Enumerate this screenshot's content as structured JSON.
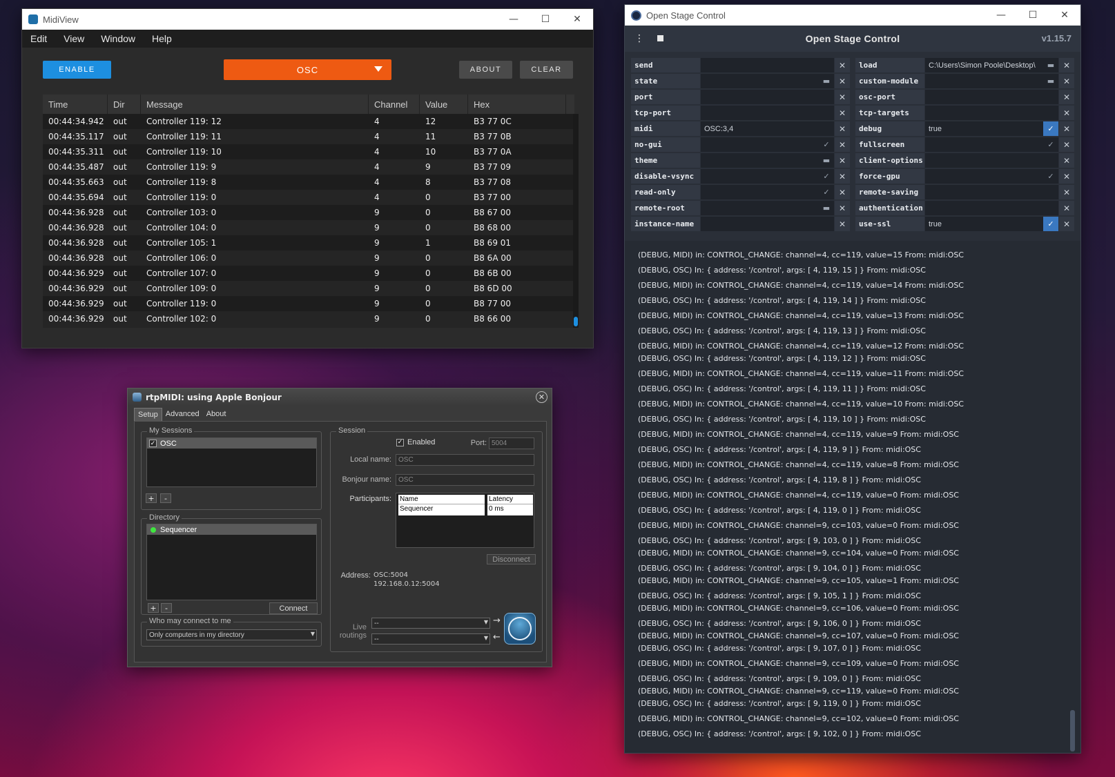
{
  "midiview": {
    "title": "MidiView",
    "menu": [
      "Edit",
      "View",
      "Window",
      "Help"
    ],
    "enable_label": "ENABLE",
    "port_selected": "OSC",
    "about_label": "ABOUT",
    "clear_label": "CLEAR",
    "columns": [
      "Time",
      "Dir",
      "Message",
      "Channel",
      "Value",
      "Hex"
    ],
    "rows": [
      [
        "00:44:34.942",
        "out",
        "Controller 119: 12",
        "4",
        "12",
        "B3 77 0C"
      ],
      [
        "00:44:35.117",
        "out",
        "Controller 119: 11",
        "4",
        "11",
        "B3 77 0B"
      ],
      [
        "00:44:35.311",
        "out",
        "Controller 119: 10",
        "4",
        "10",
        "B3 77 0A"
      ],
      [
        "00:44:35.487",
        "out",
        "Controller 119: 9",
        "4",
        "9",
        "B3 77 09"
      ],
      [
        "00:44:35.663",
        "out",
        "Controller 119: 8",
        "4",
        "8",
        "B3 77 08"
      ],
      [
        "00:44:35.694",
        "out",
        "Controller 119: 0",
        "4",
        "0",
        "B3 77 00"
      ],
      [
        "00:44:36.928",
        "out",
        "Controller 103: 0",
        "9",
        "0",
        "B8 67 00"
      ],
      [
        "00:44:36.928",
        "out",
        "Controller 104: 0",
        "9",
        "0",
        "B8 68 00"
      ],
      [
        "00:44:36.928",
        "out",
        "Controller 105: 1",
        "9",
        "1",
        "B8 69 01"
      ],
      [
        "00:44:36.928",
        "out",
        "Controller 106: 0",
        "9",
        "0",
        "B8 6A 00"
      ],
      [
        "00:44:36.929",
        "out",
        "Controller 107: 0",
        "9",
        "0",
        "B8 6B 00"
      ],
      [
        "00:44:36.929",
        "out",
        "Controller 109: 0",
        "9",
        "0",
        "B8 6D 00"
      ],
      [
        "00:44:36.929",
        "out",
        "Controller 119: 0",
        "9",
        "0",
        "B8 77 00"
      ],
      [
        "00:44:36.929",
        "out",
        "Controller 102: 0",
        "9",
        "0",
        "B8 66 00"
      ]
    ]
  },
  "osc": {
    "window_title": "Open Stage Control",
    "header_title": "Open Stage Control",
    "version": "v1.15.7",
    "options_left": [
      {
        "name": "send",
        "value": "",
        "icon": "none"
      },
      {
        "name": "state",
        "value": "",
        "icon": "folder"
      },
      {
        "name": "port",
        "value": "",
        "icon": "none"
      },
      {
        "name": "tcp-port",
        "value": "",
        "icon": "none"
      },
      {
        "name": "midi",
        "value": "OSC:3,4",
        "icon": "none"
      },
      {
        "name": "no-gui",
        "value": "",
        "icon": "check"
      },
      {
        "name": "theme",
        "value": "",
        "icon": "folder"
      },
      {
        "name": "disable-vsync",
        "value": "",
        "icon": "check"
      },
      {
        "name": "read-only",
        "value": "",
        "icon": "check"
      },
      {
        "name": "remote-root",
        "value": "",
        "icon": "folder"
      },
      {
        "name": "instance-name",
        "value": "",
        "icon": "none"
      }
    ],
    "options_right": [
      {
        "name": "load",
        "value": "C:\\Users\\Simon Poole\\Desktop\\",
        "icon": "folder"
      },
      {
        "name": "custom-module",
        "value": "",
        "icon": "folder"
      },
      {
        "name": "osc-port",
        "value": "",
        "icon": "none"
      },
      {
        "name": "tcp-targets",
        "value": "",
        "icon": "none"
      },
      {
        "name": "debug",
        "value": "true",
        "icon": "check-on"
      },
      {
        "name": "fullscreen",
        "value": "",
        "icon": "check"
      },
      {
        "name": "client-options",
        "value": "",
        "icon": "none"
      },
      {
        "name": "force-gpu",
        "value": "",
        "icon": "check"
      },
      {
        "name": "remote-saving",
        "value": "",
        "icon": "none"
      },
      {
        "name": "authentication",
        "value": "",
        "icon": "none"
      },
      {
        "name": "use-ssl",
        "value": "true",
        "icon": "check-on"
      }
    ],
    "log": [
      "(DEBUG, MIDI) in: CONTROL_CHANGE: channel=4, cc=119, value=15 From: midi:OSC",
      "(DEBUG, OSC) In:  { address: '/control', args: [ 4, 119, 15 ] } From: midi:OSC",
      "(DEBUG, MIDI) in: CONTROL_CHANGE: channel=4, cc=119, value=14 From: midi:OSC",
      "(DEBUG, OSC) In:  { address: '/control', args: [ 4, 119, 14 ] } From: midi:OSC",
      "(DEBUG, MIDI) in: CONTROL_CHANGE: channel=4, cc=119, value=13 From: midi:OSC",
      "(DEBUG, OSC) In:  { address: '/control', args: [ 4, 119, 13 ] } From: midi:OSC",
      "(DEBUG, MIDI) in: CONTROL_CHANGE: channel=4, cc=119, value=12 From: midi:OSC",
      "(DEBUG, OSC) In:  { address: '/control', args: [ 4, 119, 12 ] } From: midi:OSC",
      "(DEBUG, MIDI) in: CONTROL_CHANGE: channel=4, cc=119, value=11 From: midi:OSC",
      "(DEBUG, OSC) In:  { address: '/control', args: [ 4, 119, 11 ] } From: midi:OSC",
      "(DEBUG, MIDI) in: CONTROL_CHANGE: channel=4, cc=119, value=10 From: midi:OSC",
      "(DEBUG, OSC) In:  { address: '/control', args: [ 4, 119, 10 ] } From: midi:OSC",
      "(DEBUG, MIDI) in: CONTROL_CHANGE: channel=4, cc=119, value=9 From: midi:OSC",
      "(DEBUG, OSC) In:  { address: '/control', args: [ 4, 119, 9 ] } From: midi:OSC",
      "(DEBUG, MIDI) in: CONTROL_CHANGE: channel=4, cc=119, value=8 From: midi:OSC",
      "(DEBUG, OSC) In:  { address: '/control', args: [ 4, 119, 8 ] } From: midi:OSC",
      "(DEBUG, MIDI) in: CONTROL_CHANGE: channel=4, cc=119, value=0 From: midi:OSC",
      "(DEBUG, OSC) In:  { address: '/control', args: [ 4, 119, 0 ] } From: midi:OSC",
      "(DEBUG, MIDI) in: CONTROL_CHANGE: channel=9, cc=103, value=0 From: midi:OSC",
      "(DEBUG, OSC) In:  { address: '/control', args: [ 9, 103, 0 ] } From: midi:OSC",
      "(DEBUG, MIDI) in: CONTROL_CHANGE: channel=9, cc=104, value=0 From: midi:OSC",
      "(DEBUG, OSC) In:  { address: '/control', args: [ 9, 104, 0 ] } From: midi:OSC",
      "(DEBUG, MIDI) in: CONTROL_CHANGE: channel=9, cc=105, value=1 From: midi:OSC",
      "(DEBUG, OSC) In:  { address: '/control', args: [ 9, 105, 1 ] } From: midi:OSC",
      "(DEBUG, MIDI) in: CONTROL_CHANGE: channel=9, cc=106, value=0 From: midi:OSC",
      "(DEBUG, OSC) In:  { address: '/control', args: [ 9, 106, 0 ] } From: midi:OSC",
      "(DEBUG, MIDI) in: CONTROL_CHANGE: channel=9, cc=107, value=0 From: midi:OSC",
      "(DEBUG, OSC) In:  { address: '/control', args: [ 9, 107, 0 ] } From: midi:OSC",
      "(DEBUG, MIDI) in: CONTROL_CHANGE: channel=9, cc=109, value=0 From: midi:OSC",
      "(DEBUG, OSC) In:  { address: '/control', args: [ 9, 109, 0 ] } From: midi:OSC",
      "(DEBUG, MIDI) in: CONTROL_CHANGE: channel=9, cc=119, value=0 From: midi:OSC",
      "(DEBUG, OSC) In:  { address: '/control', args: [ 9, 119, 0 ] } From: midi:OSC",
      "(DEBUG, MIDI) in: CONTROL_CHANGE: channel=9, cc=102, value=0 From: midi:OSC",
      "(DEBUG, OSC) In:  { address: '/control', args: [ 9, 102, 0 ] } From: midi:OSC"
    ]
  },
  "rtpmidi": {
    "title": "rtpMIDI: using Apple Bonjour",
    "tabs": [
      "Setup",
      "Advanced",
      "About"
    ],
    "my_sessions_label": "My Sessions",
    "session_name": "OSC",
    "directory_label": "Directory",
    "directory_entry": "Sequencer",
    "connect_label": "Connect",
    "who_label": "Who may connect to me",
    "who_value": "Only computers in my directory",
    "session_group_label": "Session",
    "enabled_label": "Enabled",
    "port_label": "Port:",
    "port_value": "5004",
    "local_name_label": "Local name:",
    "local_name_value": "OSC",
    "bonjour_name_label": "Bonjour name:",
    "bonjour_name_value": "OSC",
    "participants_label": "Participants:",
    "participants_header": [
      "Name",
      "Latency"
    ],
    "participants_row": [
      "Sequencer",
      "0 ms"
    ],
    "disconnect_label": "Disconnect",
    "address_label": "Address:",
    "address_line1": "OSC:5004",
    "address_line2": "192.168.0.12:5004",
    "live_routings_label_1": "Live",
    "live_routings_label_2": "routings",
    "routing_in": "--",
    "routing_out": "--",
    "plus": "+",
    "minus": "-"
  }
}
